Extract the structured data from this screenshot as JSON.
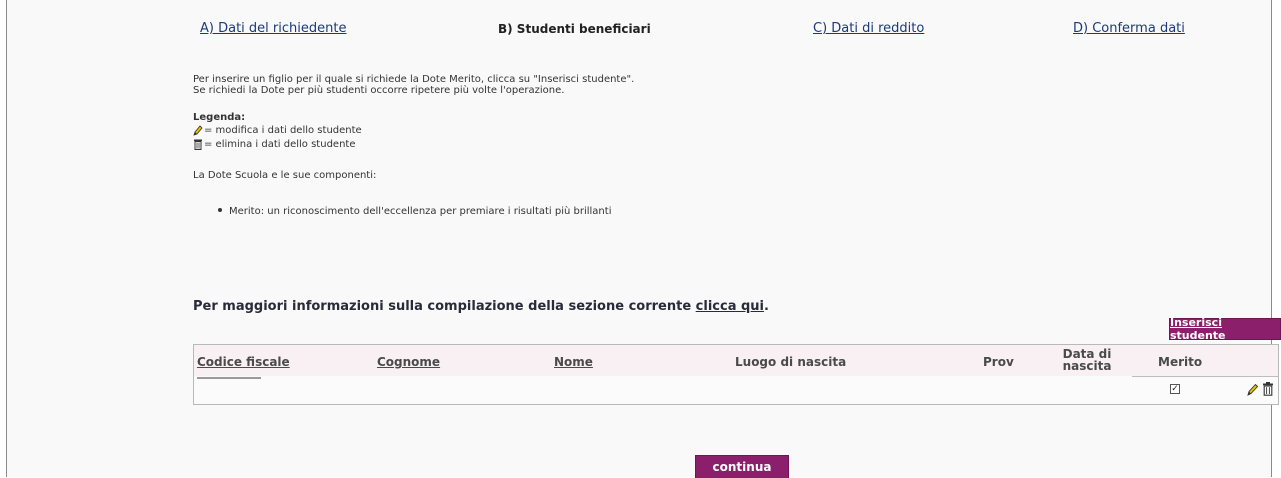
{
  "steps": {
    "a": "A) Dati del richiedente",
    "b": "B) Studenti beneficiari",
    "c": "C) Dati di reddito",
    "d": "D) Conferma dati"
  },
  "intro": {
    "line1": "Per inserire un figlio per il quale si richiede la Dote Merito, clicca su \"Inserisci studente\".",
    "line2": "Se richiedi la Dote per più studenti occorre ripetere più volte l'operazione."
  },
  "legend": {
    "title": "Legenda:",
    "edit": "= modifica i dati dello studente",
    "delete": "= elimina i dati dello studente"
  },
  "dote": {
    "title": "La Dote Scuola e le sue componenti:",
    "items": [
      "Merito: un riconoscimento dell'eccellenza per premiare i risultati più brillanti"
    ]
  },
  "more_info": {
    "text": "Per maggiori informazioni sulla compilazione della sezione corrente ",
    "link": "clicca qui",
    "end": "."
  },
  "buttons": {
    "insert": "Inserisci studente",
    "continue": "continua"
  },
  "table": {
    "columns": {
      "codice_fiscale": "Codice fiscale",
      "cognome": "Cognome",
      "nome": "Nome",
      "luogo": "Luogo di nascita",
      "prov": "Prov",
      "data_line1": "Data di",
      "data_line2": "nascita",
      "merito": "Merito"
    },
    "row": {
      "merito_checked": true
    }
  },
  "colors": {
    "accent": "#8b1f6b",
    "link": "#1a3a7a"
  },
  "icons": {
    "edit": "pencil-icon",
    "delete": "trash-icon",
    "check": "checkbox-icon"
  }
}
